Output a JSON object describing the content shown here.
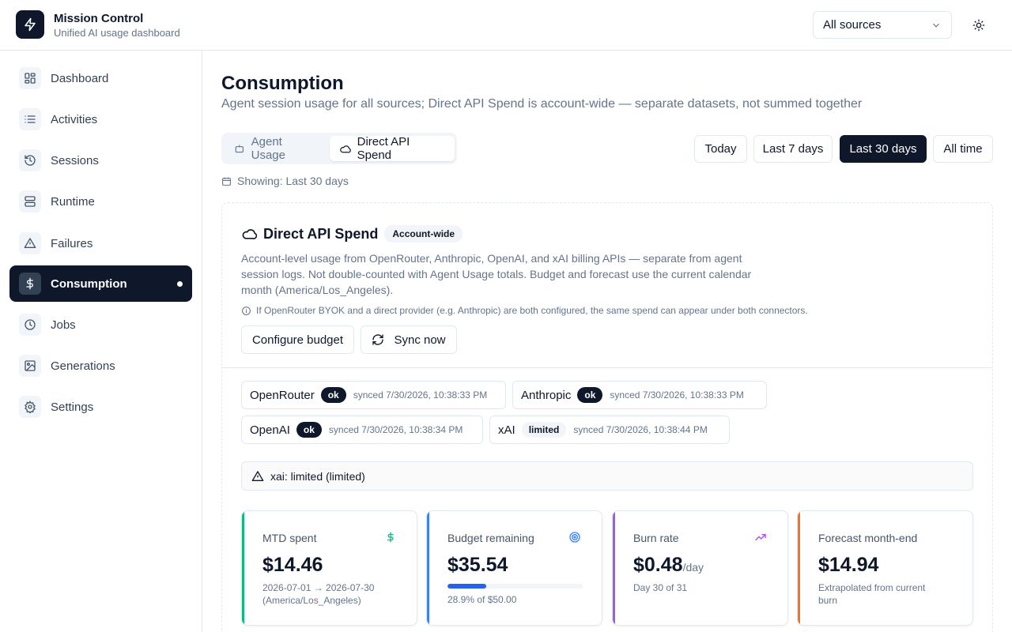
{
  "app": {
    "title": "Mission Control",
    "subtitle": "Unified AI usage dashboard"
  },
  "header": {
    "source_select": "All sources",
    "icons": [
      "bolt-icon",
      "chevron-down-icon",
      "sun-icon"
    ]
  },
  "sidebar": {
    "items": [
      {
        "label": "Dashboard",
        "icon": "layout-grid-icon"
      },
      {
        "label": "Activities",
        "icon": "list-icon"
      },
      {
        "label": "Sessions",
        "icon": "history-icon"
      },
      {
        "label": "Runtime",
        "icon": "server-icon"
      },
      {
        "label": "Failures",
        "icon": "alert-triangle-icon"
      },
      {
        "label": "Consumption",
        "icon": "dollar-icon",
        "active": true
      },
      {
        "label": "Jobs",
        "icon": "clock-icon"
      },
      {
        "label": "Generations",
        "icon": "image-icon"
      },
      {
        "label": "Settings",
        "icon": "gear-icon"
      }
    ]
  },
  "page": {
    "title": "Consumption",
    "subtitle": "Agent session usage for all sources; Direct API Spend is account-wide — separate datasets, not summed together",
    "tabs": [
      "Agent Usage",
      "Direct API Spend"
    ],
    "active_tab": "Direct API Spend",
    "ranges": [
      "Today",
      "Last 7 days",
      "Last 30 days",
      "All time"
    ],
    "active_range": "Last 30 days",
    "showing": "Showing: Last 30 days"
  },
  "card": {
    "title": "Direct API Spend",
    "badge": "Account-wide",
    "description": "Account-level usage from OpenRouter, Anthropic, OpenAI, and xAI billing APIs — separate from agent session logs. Not double-counted with Agent Usage totals. Budget and forecast use the current calendar month (America/Los_Angeles).",
    "note": "If OpenRouter BYOK and a direct provider (e.g. Anthropic) are both configured, the same spend can appear under both connectors.",
    "configure_button": "Configure budget",
    "sync_button": "Sync now",
    "connectors": [
      {
        "name": "OpenRouter",
        "status": "ok",
        "synced": "synced 7/30/2026, 10:38:33 PM"
      },
      {
        "name": "Anthropic",
        "status": "ok",
        "synced": "synced 7/30/2026, 10:38:33 PM"
      },
      {
        "name": "OpenAI",
        "status": "ok",
        "synced": "synced 7/30/2026, 10:38:34 PM"
      },
      {
        "name": "xAI",
        "status": "limited",
        "synced": "synced 7/30/2026, 10:38:44 PM"
      }
    ],
    "alert": "xai: limited (limited)"
  },
  "stats": [
    {
      "label": "MTD spent",
      "value": "$14.46",
      "desc": "2026-07-01 → 2026-07-30 (America/Los_Angeles)",
      "accent": "#10b981",
      "icon": "dollar-icon"
    },
    {
      "label": "Budget remaining",
      "value": "$35.54",
      "desc": "28.9% of $50.00",
      "accent": "#3b82f6",
      "icon": "target-icon",
      "progress": 0.289
    },
    {
      "label": "Burn rate",
      "value": "$0.48",
      "unit": "/day",
      "desc": "Day 30 of 31",
      "accent": "#a855f7",
      "icon": "trending-up-icon"
    },
    {
      "label": "Forecast month-end",
      "value": "$14.94",
      "desc": "Extrapolated from current burn",
      "accent": "#f97316",
      "icon": "forecast-icon"
    }
  ]
}
